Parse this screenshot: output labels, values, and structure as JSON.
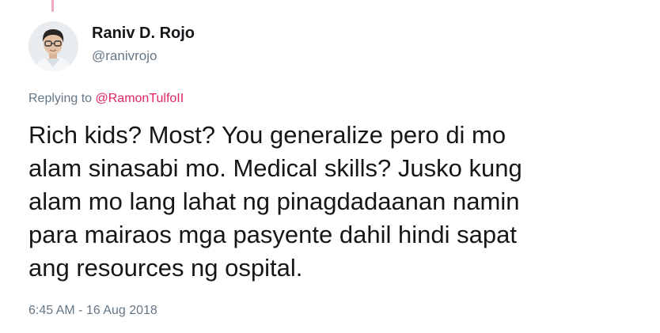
{
  "tweet": {
    "author": {
      "display_name": "Raniv D. Rojo",
      "handle": "@ranivrojo",
      "avatar_icon": "profile-photo"
    },
    "replying_to": {
      "prefix": "Replying to",
      "mention": "@RamonTulfoII"
    },
    "text": "Rich kids? Most? You generalize pero di mo\nalam sinasabi mo. Medical skills? Jusko kung\nalam mo lang lahat ng pinagdadaanan namin\npara mairaos mga pasyente dahil hindi sapat\nang resources ng ospital.",
    "timestamp": "6:45 AM - 16 Aug 2018"
  },
  "colors": {
    "text_primary": "#14171a",
    "text_secondary": "#657786",
    "mention": "#e0245e",
    "thread_line": "#f0a8c4"
  }
}
